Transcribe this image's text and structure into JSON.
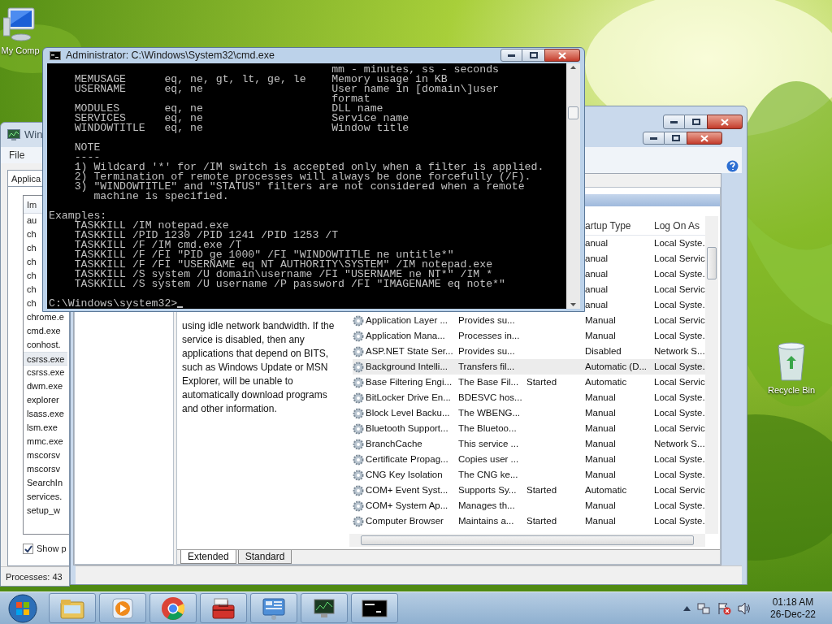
{
  "desktop_icons": [
    {
      "kind": "computer",
      "label": "My Comp"
    },
    {
      "kind": "recycle-bin",
      "label": "Recycle Bin"
    }
  ],
  "task_manager": {
    "title": "Win",
    "menu": [
      "File"
    ],
    "tab": "Applica",
    "column": "Im",
    "processes": [
      {
        "name": "au",
        "selected": false
      },
      {
        "name": "ch",
        "selected": false
      },
      {
        "name": "ch",
        "selected": false
      },
      {
        "name": "ch",
        "selected": false
      },
      {
        "name": "ch",
        "selected": false
      },
      {
        "name": "ch",
        "selected": false
      },
      {
        "name": "ch",
        "selected": false
      },
      {
        "name": "chrome.e",
        "selected": false
      },
      {
        "name": "cmd.exe",
        "selected": false
      },
      {
        "name": "conhost.",
        "selected": false
      },
      {
        "name": "csrss.exe",
        "selected": true
      },
      {
        "name": "csrss.exe",
        "selected": false
      },
      {
        "name": "dwm.exe",
        "selected": false
      },
      {
        "name": "explorer",
        "selected": false
      },
      {
        "name": "lsass.exe",
        "selected": false
      },
      {
        "name": "lsm.exe",
        "selected": false
      },
      {
        "name": "mmc.exe",
        "selected": false
      },
      {
        "name": "mscorsv",
        "selected": false
      },
      {
        "name": "mscorsv",
        "selected": false
      },
      {
        "name": "SearchIn",
        "selected": false
      },
      {
        "name": "services.",
        "selected": false
      },
      {
        "name": "setup_w",
        "selected": false
      }
    ],
    "show_all": {
      "label": "Show p",
      "checked": true
    },
    "status": "Processes: 43"
  },
  "services": {
    "columns": [
      "artup Type",
      "Log On As"
    ],
    "description": "using idle network bandwidth. If the service is disabled, then any applications that depend on BITS, such as Windows Update or MSN Explorer, will be unable to automatically download programs and other information.",
    "rows": [
      {
        "startup": "anual",
        "logon": "Local Syste.",
        "selected": false
      },
      {
        "startup": "anual",
        "logon": "Local Servic",
        "selected": false
      },
      {
        "startup": "anual",
        "logon": "Local Syste.",
        "selected": false
      },
      {
        "startup": "anual",
        "logon": "Local Servic",
        "selected": false
      },
      {
        "startup": "anual",
        "logon": "Local Syste.",
        "selected": false
      },
      {
        "name": "Application Layer ...",
        "description": "Provides su...",
        "startup": "Manual",
        "logon": "Local Servic",
        "selected": false
      },
      {
        "name": "Application Mana...",
        "description": "Processes in...",
        "startup": "Manual",
        "logon": "Local Syste.",
        "selected": false
      },
      {
        "name": "ASP.NET State Ser...",
        "description": "Provides su...",
        "startup": "Disabled",
        "logon": "Network S...",
        "selected": false
      },
      {
        "name": "Background Intelli...",
        "description": "Transfers fil...",
        "startup": "Automatic (D...",
        "logon": "Local Syste.",
        "selected": true
      },
      {
        "name": "Base Filtering Engi...",
        "description": "The Base Fil...",
        "status": "Started",
        "startup": "Automatic",
        "logon": "Local Servic",
        "selected": false
      },
      {
        "name": "BitLocker Drive En...",
        "description": "BDESVC hos...",
        "startup": "Manual",
        "logon": "Local Syste.",
        "selected": false
      },
      {
        "name": "Block Level Backu...",
        "description": "The WBENG...",
        "startup": "Manual",
        "logon": "Local Syste.",
        "selected": false
      },
      {
        "name": "Bluetooth Support...",
        "description": "The Bluetoo...",
        "startup": "Manual",
        "logon": "Local Servic",
        "selected": false
      },
      {
        "name": "BranchCache",
        "description": "This service ...",
        "startup": "Manual",
        "logon": "Network S...",
        "selected": false
      },
      {
        "name": "Certificate Propag...",
        "description": "Copies user ...",
        "startup": "Manual",
        "logon": "Local Syste.",
        "selected": false
      },
      {
        "name": "CNG Key Isolation",
        "description": "The CNG ke...",
        "startup": "Manual",
        "logon": "Local Syste.",
        "selected": false
      },
      {
        "name": "COM+ Event Syst...",
        "description": "Supports Sy...",
        "status": "Started",
        "startup": "Automatic",
        "logon": "Local Servic",
        "selected": false
      },
      {
        "name": "COM+ System Ap...",
        "description": "Manages th...",
        "startup": "Manual",
        "logon": "Local Syste.",
        "selected": false
      },
      {
        "name": "Computer Browser",
        "description": "Maintains a...",
        "status": "Started",
        "startup": "Manual",
        "logon": "Local Syste.",
        "selected": false
      }
    ],
    "tabs": [
      {
        "label": "Extended",
        "selected": true
      },
      {
        "label": "Standard",
        "selected": false
      }
    ]
  },
  "console": {
    "title": "Administrator: C:\\Windows\\System32\\cmd.exe",
    "blocks": [
      [
        "                                            mm - minutes, ss - seconds",
        "    MEMUSAGE      eq, ne, gt, lt, ge, le    Memory usage in KB",
        "    USERNAME      eq, ne                    User name in [domain\\]user",
        "                                            format",
        "    MODULES       eq, ne                    DLL name",
        "    SERVICES      eq, ne                    Service name",
        "    WINDOWTITLE   eq, ne                    Window title"
      ],
      [
        "    NOTE",
        "    ----",
        "    1) Wildcard '*' for /IM switch is accepted only when a filter is applied.",
        "    2) Termination of remote processes will always be done forcefully (/F).",
        "    3) \"WINDOWTITLE\" and \"STATUS\" filters are not considered when a remote",
        "       machine is specified."
      ],
      [
        "Examples:",
        "    TASKKILL /IM notepad.exe",
        "    TASKKILL /PID 1230 /PID 1241 /PID 1253 /T",
        "    TASKKILL /F /IM cmd.exe /T",
        "    TASKKILL /F /FI \"PID ge 1000\" /FI \"WINDOWTITLE ne untitle*\"",
        "    TASKKILL /F /FI \"USERNAME eq NT AUTHORITY\\SYSTEM\" /IM notepad.exe",
        "    TASKKILL /S system /U domain\\username /FI \"USERNAME ne NT*\" /IM *",
        "    TASKKILL /S system /U username /P password /FI \"IMAGENAME eq note*\""
      ]
    ],
    "prompt": "C:\\Windows\\system32>"
  },
  "taskbar": {
    "apps": [
      {
        "kind": "folder"
      },
      {
        "kind": "media"
      },
      {
        "kind": "browser"
      },
      {
        "kind": "toolbox"
      },
      {
        "kind": "control-panel"
      },
      {
        "kind": "monitor"
      },
      {
        "kind": "console"
      }
    ],
    "clock": {
      "time": "01:18 AM",
      "date": "26-Dec-22"
    }
  }
}
